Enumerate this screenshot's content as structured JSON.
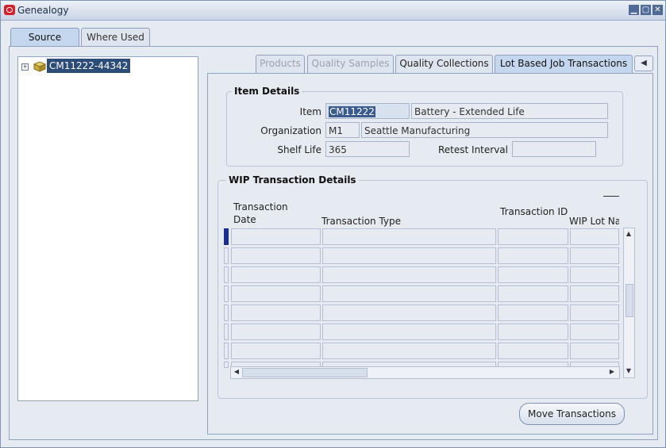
{
  "window": {
    "title": "Genealogy",
    "controls": [
      "minimize",
      "maximize",
      "close"
    ]
  },
  "top_tabs": [
    {
      "label": "Source",
      "active": true
    },
    {
      "label": "Where Used",
      "active": false
    }
  ],
  "tree": {
    "node_label": "CM11222-44342",
    "expander": "+"
  },
  "sub_tabs": [
    {
      "label": "Products",
      "state": "disabled"
    },
    {
      "label": "Quality Samples",
      "state": "disabled"
    },
    {
      "label": "Quality Collections",
      "state": "enabled"
    },
    {
      "label": "Lot Based Job Transactions",
      "state": "active"
    }
  ],
  "item_details": {
    "title": "Item Details",
    "item_label": "Item",
    "item_value": "CM11222",
    "item_description": "Battery - Extended Life",
    "org_label": "Organization",
    "org_code": "M1",
    "org_name": "Seattle Manufacturing",
    "shelf_life_label": "Shelf Life",
    "shelf_life_value": "365",
    "retest_label": "Retest Interval",
    "retest_value": ""
  },
  "wip_details": {
    "title": "WIP Transaction Details",
    "columns": {
      "date_line1": "Transaction",
      "date_line2": "Date",
      "type": "Transaction Type",
      "id": "Transaction ID",
      "wip_lot": "WIP Lot Na"
    },
    "rows": 8
  },
  "buttons": {
    "move_transactions": "Move Transactions"
  }
}
